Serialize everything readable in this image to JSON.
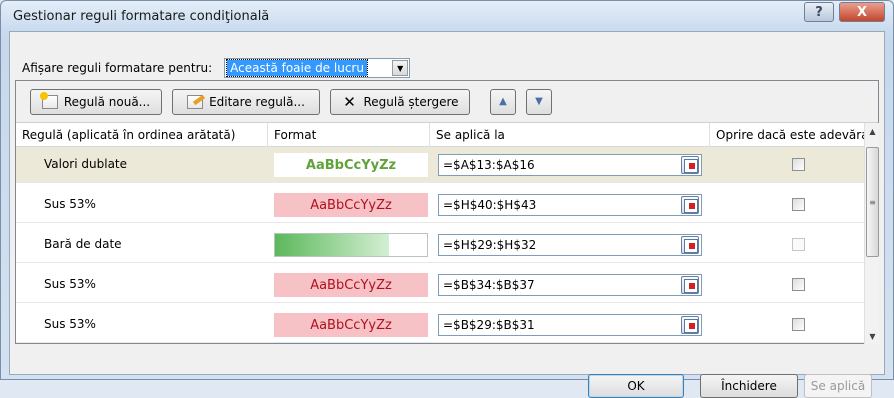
{
  "window": {
    "title": "Gestionar reguli formatare condiţională",
    "help_label": "?",
    "close_label": "X"
  },
  "show_rules": {
    "label": "Afișare reguli formatare pentru:",
    "selected": "Această foaie de lucru"
  },
  "toolbar": {
    "new_rule": "Regulă nouă...",
    "edit_rule": "Editare regulă...",
    "delete_rule": "Regulă ștergere",
    "move_up_icon": "up-arrow-icon",
    "move_down_icon": "down-arrow-icon"
  },
  "columns": {
    "rule": "Regulă (aplicată în ordinea arătată)",
    "format": "Format",
    "applies_to": "Se aplică la",
    "stop_if_true": "Oprire dacă este adevărat"
  },
  "rules": [
    {
      "name": "Valori dublate",
      "preview": "AaBbCcYyZz",
      "style": "green",
      "range": "=$A$13:$A$16",
      "stop": false,
      "selected": true
    },
    {
      "name": "Sus 53%",
      "preview": "AaBbCcYyZz",
      "style": "pink",
      "range": "=$H$40:$H$43",
      "stop": false,
      "selected": false
    },
    {
      "name": "Bară de date",
      "preview": "",
      "style": "bar",
      "range": "=$H$29:$H$32",
      "stop": false,
      "selected": false
    },
    {
      "name": "Sus 53%",
      "preview": "AaBbCcYyZz",
      "style": "pink",
      "range": "=$B$34:$B$37",
      "stop": false,
      "selected": false
    },
    {
      "name": "Sus 53%",
      "preview": "AaBbCcYyZz",
      "style": "pink",
      "range": "=$B$29:$B$31",
      "stop": false,
      "selected": false
    }
  ],
  "buttons": {
    "ok": "OK",
    "close": "Închidere",
    "apply": "Se aplică"
  },
  "colors": {
    "selected_row": "#ece9d8",
    "pink_fill": "#f7c2c6",
    "pink_text": "#b0101e",
    "green_text": "#5fa33a",
    "bar_green": "#5cb85c"
  }
}
